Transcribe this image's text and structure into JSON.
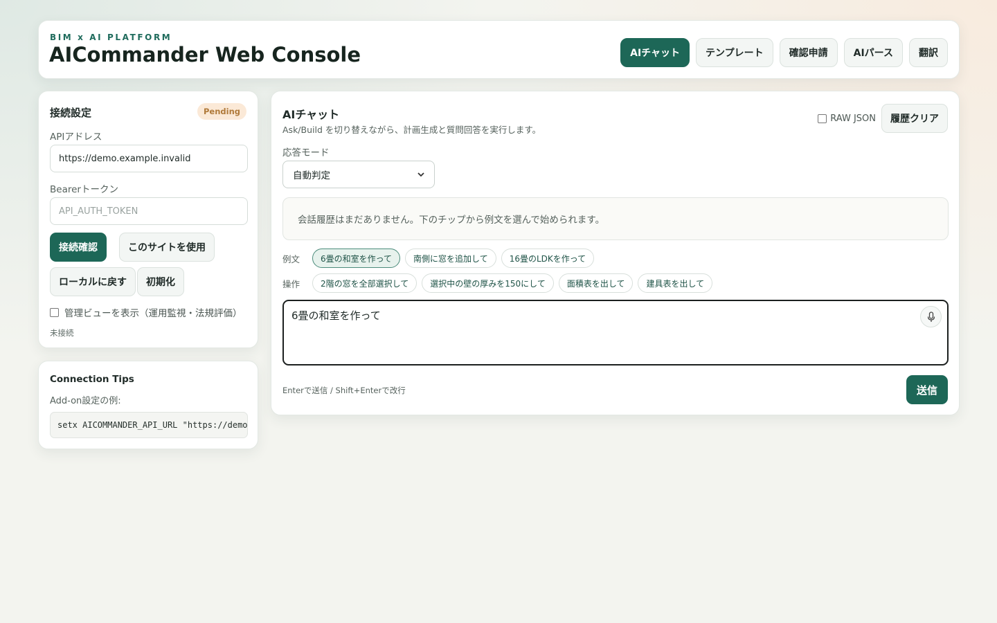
{
  "header": {
    "kicker": "BIM x AI PLATFORM",
    "title": "AICommander Web Console",
    "nav": [
      {
        "label": "AIチャット",
        "active": true
      },
      {
        "label": "テンプレート",
        "active": false
      },
      {
        "label": "確認申請",
        "active": false
      },
      {
        "label": "AIパース",
        "active": false
      },
      {
        "label": "翻訳",
        "active": false
      }
    ]
  },
  "connection": {
    "title": "接続設定",
    "badge": "Pending",
    "api_label": "APIアドレス",
    "api_value": "https://demo.example.invalid",
    "token_label": "Bearerトークン",
    "token_placeholder": "API_AUTH_TOKEN",
    "btn_check": "接続確認",
    "btn_use_site": "このサイトを使用",
    "btn_local": "ローカルに戻す",
    "btn_reset": "初期化",
    "admin_view_label": "管理ビューを表示（運用監視・法規評価）",
    "status": "未接続"
  },
  "tips": {
    "title": "Connection Tips",
    "subtitle": "Add-on設定の例:",
    "code": "setx AICOMMANDER_API_URL \"https://demo"
  },
  "chat": {
    "title": "AIチャット",
    "subtitle": "Ask/Build を切り替えながら、計画生成と質問回答を実行します。",
    "raw_json_label": "RAW JSON",
    "clear_label": "履歴クリア",
    "mode_label": "応答モード",
    "mode_value": "自動判定",
    "history_empty": "会話履歴はまだありません。下のチップから例文を選んで始められます。",
    "examples_label": "例文",
    "examples": [
      "6畳の和室を作って",
      "南側に窓を追加して",
      "16畳のLDKを作って"
    ],
    "ops_label": "操作",
    "ops": [
      "2階の窓を全部選択して",
      "選択中の壁の厚みを150にして",
      "面積表を出して",
      "建具表を出して"
    ],
    "input_value": "6畳の和室を作って",
    "hint": "Enterで送信 / Shift+Enterで改行",
    "send_label": "送信"
  },
  "colors": {
    "accent": "#1d6757",
    "badge_bg": "#fbe9d7",
    "badge_text": "#b07a3a"
  }
}
